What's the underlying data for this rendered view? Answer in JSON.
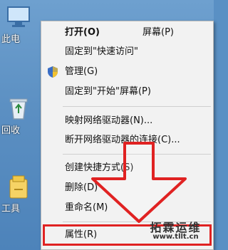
{
  "desktop": {
    "icons": [
      {
        "label": "此电",
        "icon": "computer-icon"
      },
      {
        "label": "回收",
        "icon": "recycle-bin-icon"
      },
      {
        "label": "工具",
        "icon": "tools-icon"
      }
    ]
  },
  "context_menu": {
    "items": [
      {
        "label": "打开(O)",
        "bold": true
      },
      {
        "label": "固定到\"快速访问\""
      },
      {
        "label": "管理(G)",
        "icon": "shield-icon"
      },
      {
        "label": "固定到\"开始\"屏幕(P)"
      },
      {
        "label": "映射网络驱动器(N)..."
      },
      {
        "label": "断开网络驱动器的连接(C)..."
      },
      {
        "label": "创建快捷方式(S)"
      },
      {
        "label": "删除(D)"
      },
      {
        "label": "重命名(M)"
      },
      {
        "label": "属性(R)"
      }
    ],
    "top_right_fragment": "屏幕(P)"
  },
  "annotation": {
    "highlight_color": "#e02222",
    "arrow_color": "#e02222",
    "watermark_title": "拓霖运维",
    "watermark_url": "www.tllt.cn"
  }
}
